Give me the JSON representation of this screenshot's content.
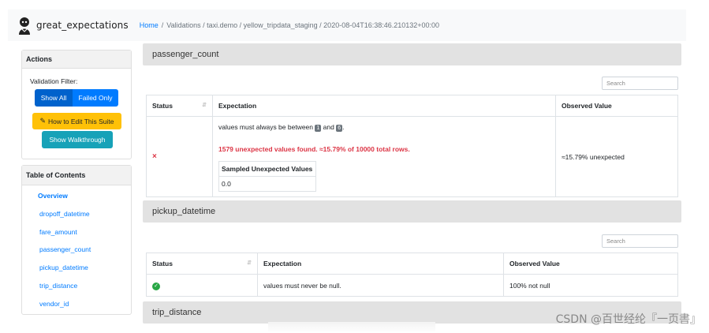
{
  "brand": {
    "name": "great_expectations",
    "logo_icon": "great-expectations-logo"
  },
  "breadcrumb": {
    "home": "Home",
    "separator": "/",
    "path": "Validations / taxi.demo / yellow_tripdata_staging / 2020-08-04T16:38:46.210132+00:00"
  },
  "actions": {
    "title": "Actions",
    "filter_label": "Validation Filter:",
    "show_all": "Show All",
    "failed_only": "Failed Only",
    "edit_suite": "How to Edit This Suite",
    "walkthrough": "Show Walkthrough"
  },
  "toc": {
    "title": "Table of Contents",
    "items": [
      "Overview",
      "dropoff_datetime",
      "fare_amount",
      "passenger_count",
      "pickup_datetime",
      "trip_distance",
      "vendor_id"
    ]
  },
  "sections": [
    {
      "title": "passenger_count",
      "search_placeholder": "Search",
      "columns": [
        "Status",
        "Expectation",
        "Observed Value"
      ],
      "rows": [
        {
          "status": "failed",
          "status_glyph": "×",
          "expectation_prefix": "values must always be between",
          "min": "1",
          "and": "and",
          "max": "6",
          "suffix": ".",
          "error": "1579 unexpected values found. ≈15.79% of 10000 total rows.",
          "sampled_title": "Sampled Unexpected Values",
          "sampled_value": "0.0",
          "observed": "≈15.79% unexpected"
        }
      ]
    },
    {
      "title": "pickup_datetime",
      "search_placeholder": "Search",
      "columns": [
        "Status",
        "Expectation",
        "Observed Value"
      ],
      "rows": [
        {
          "status": "passed",
          "status_glyph": "✓",
          "expectation": "values must never be null.",
          "observed": "100% not null"
        }
      ]
    },
    {
      "title": "trip_distance"
    }
  ],
  "colors": {
    "primary": "#007bff",
    "danger": "#dc3545",
    "success": "#28a745",
    "warning": "#ffc107",
    "info": "#17a2b8"
  },
  "watermark": "CSDN @百世经纶『一页書』"
}
